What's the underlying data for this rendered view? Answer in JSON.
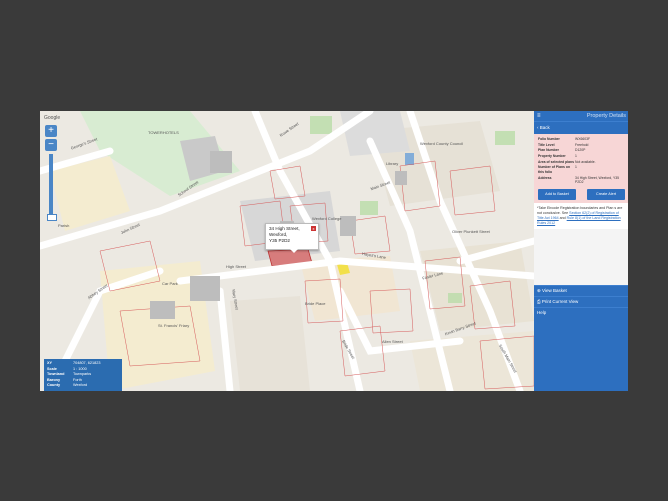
{
  "map": {
    "google_tag": "Google",
    "zoom_in": "+",
    "zoom_out": "−",
    "labels": {
      "tower_hotel": "TOWERHOTELS",
      "high_street": "High Street",
      "mary_street": "Mary Street",
      "rowe_street": "Rowe Street",
      "main_street": "Main Street",
      "school_street": "School Street",
      "bride_street": "Bride Street",
      "st_francis": "St. Francis' Friary",
      "car_park": "Car Park",
      "foster_lane": "Foster Lane",
      "abbey_street": "Abbey Street",
      "kevin_barry": "Kevin Barry Street",
      "allen_street": "Allen Street",
      "wexford_college": "Wexford College",
      "wexford_county": "Wexford County Council",
      "hayes_lane": "Hayes's Lane",
      "oliver_plunkett": "Oliver Plunkett Street",
      "south_main": "South Main Street",
      "georges_street": "George's Street",
      "john_street": "John Street",
      "bride_place": "Bride Place",
      "library": "Library",
      "parish": "Parish"
    },
    "popup": {
      "line1": "34 High Street,",
      "line2": "Wexford,",
      "line3": "Y35 P2D2",
      "close": "x"
    },
    "info": {
      "rows": [
        {
          "key": "XY",
          "value": "704807, 621823"
        },
        {
          "key": "Scale",
          "value": "1 : 1000"
        },
        {
          "key": "Townland",
          "value": "Townparks"
        },
        {
          "key": "Barony",
          "value": "Forth"
        },
        {
          "key": "County",
          "value": "Wexford"
        }
      ]
    }
  },
  "panel": {
    "menu_icon": "≡",
    "title": "Property Details",
    "back": "‹  Back",
    "details": [
      {
        "key": "Folio Number",
        "value": "WX6603F"
      },
      {
        "key": "Title Level",
        "value": "Freehold"
      },
      {
        "key": "Plan Number",
        "value": "D120P"
      },
      {
        "key": "Property Number",
        "value": "1"
      },
      {
        "key": "Area of selected plans",
        "value": "Not available."
      },
      {
        "key": "Number of Plans on this folio",
        "value": "1"
      },
      {
        "key": "Address",
        "value": "34 High Street, Wexford, Y35 P2D2"
      }
    ],
    "add_to_basket": "Add to Basket",
    "create_alert": "Create Alert",
    "disclaimer_a": "*Take Eircode Registration boundaries and Plan",
    "disclaimer_b": "s are not conclusive. See",
    "disclaimer_link1": "Section 62(2) of Registration of Title Act 1964",
    "disclaimer_c": "and",
    "disclaimer_link2": "Rule 8(1) of the Land Registration Rules 2012",
    "view_basket": "⊕  View Basket",
    "print_view": "⎙  Print Current View",
    "help": "Help"
  },
  "colors": {
    "accent": "#2d6fbf",
    "details_bg": "#f7d6d6",
    "background": "#3a3a3a"
  }
}
